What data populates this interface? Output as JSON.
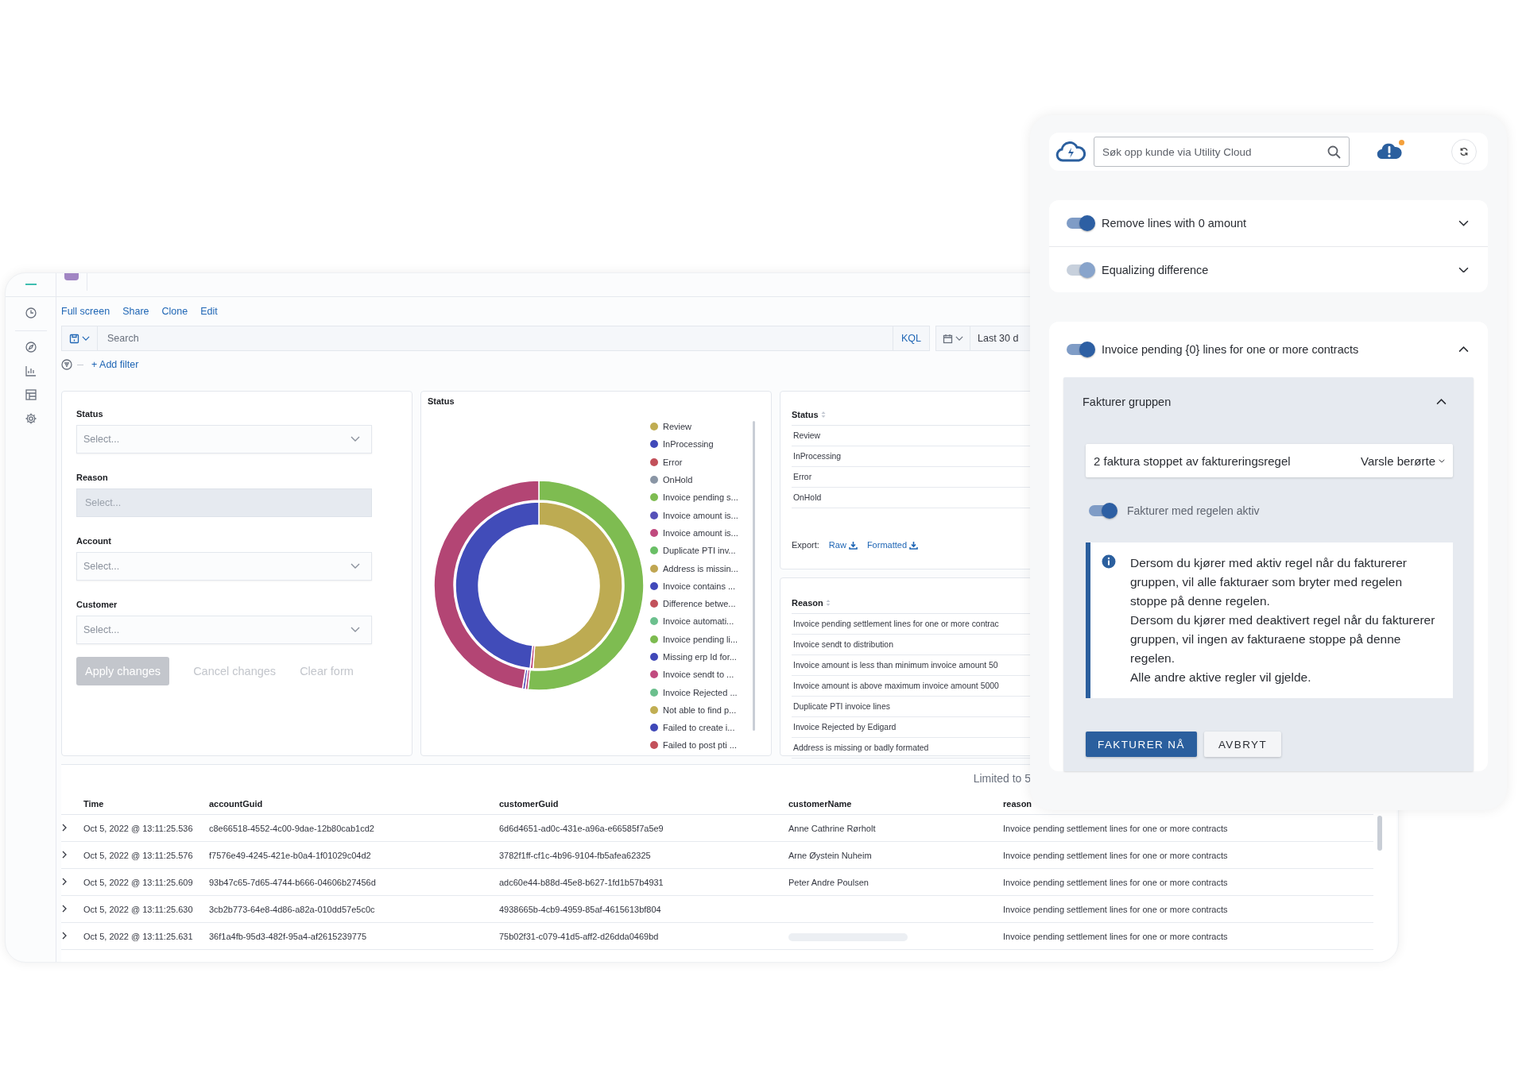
{
  "dashboard": {
    "top_links": [
      "Full screen",
      "Share",
      "Clone",
      "Edit"
    ],
    "search": {
      "placeholder": "Search",
      "language": "KQL"
    },
    "date_range": "Last 30 d",
    "add_filter": "+ Add filter",
    "filters": {
      "fields": [
        {
          "label": "Status",
          "placeholder": "Select...",
          "disabled": false
        },
        {
          "label": "Reason",
          "placeholder": "Select...",
          "disabled": true
        },
        {
          "label": "Account",
          "placeholder": "Select...",
          "disabled": false
        },
        {
          "label": "Customer",
          "placeholder": "Select...",
          "disabled": false
        }
      ],
      "buttons": [
        {
          "label": "Apply changes",
          "kind": "filled",
          "disabled": true
        },
        {
          "label": "Cancel changes",
          "kind": "text",
          "disabled": true
        },
        {
          "label": "Clear form",
          "kind": "text",
          "disabled": true
        }
      ]
    },
    "status_chart": {
      "title": "Status",
      "legend": [
        {
          "label": "Review",
          "color": "#c0ad52"
        },
        {
          "label": "InProcessing",
          "color": "#4049b9"
        },
        {
          "label": "Error",
          "color": "#c2505a"
        },
        {
          "label": "OnHold",
          "color": "#8a96a5"
        },
        {
          "label": "Invoice pending s...",
          "color": "#7ebc51"
        },
        {
          "label": "Invoice amount is...",
          "color": "#5651b8"
        },
        {
          "label": "Invoice amount is...",
          "color": "#c04a7e"
        },
        {
          "label": "Duplicate PTI inv...",
          "color": "#6abf66"
        },
        {
          "label": "Address is missin...",
          "color": "#c0a652"
        },
        {
          "label": "Invoice contains ...",
          "color": "#4149ba"
        },
        {
          "label": "Difference betwe...",
          "color": "#c2515b"
        },
        {
          "label": "Invoice automati...",
          "color": "#6cc08e"
        },
        {
          "label": "Invoice pending li...",
          "color": "#7dbb50"
        },
        {
          "label": "Missing erp Id for...",
          "color": "#4048b8"
        },
        {
          "label": "Invoice sendt to ...",
          "color": "#c14b7f"
        },
        {
          "label": "Invoice Rejected ...",
          "color": "#6bbf8d"
        },
        {
          "label": "Not able to find p...",
          "color": "#c1ae53"
        },
        {
          "label": "Failed to create i...",
          "color": "#3f48b8"
        },
        {
          "label": "Failed to post pti ...",
          "color": "#c3515b"
        }
      ]
    },
    "status_table": {
      "column": "Status",
      "rows": [
        "Review",
        "InProcessing",
        "Error",
        "OnHold"
      ],
      "export_label": "Export:",
      "export_links": [
        "Raw",
        "Formatted"
      ]
    },
    "reason_table": {
      "column": "Reason",
      "rows": [
        "Invoice pending settlement lines for one or more contrac",
        "Invoice sendt to distribution",
        "Invoice amount is less than minimum invoice amount 50",
        "Invoice amount is above maximum invoice amount 5000",
        "Duplicate PTI invoice lines",
        "Invoice Rejected by Edigard",
        "Address is missing or badly formated"
      ]
    },
    "documents": {
      "hits": "Limited to 5",
      "columns": [
        "Time",
        "accountGuid",
        "customerGuid",
        "customerName",
        "reason"
      ],
      "rows": [
        {
          "time": "Oct 5, 2022 @ 13:11:25.536",
          "account_guid": "c8e66518-4552-4c00-9dae-12b80cab1cd2",
          "customer_guid": "6d6d4651-ad0c-431e-a96a-e66585f7a5e9",
          "customer_name": "Anne Cathrine Rørholt",
          "reason": "Invoice pending settlement lines for one or more contracts",
          "loading": false
        },
        {
          "time": "Oct 5, 2022 @ 13:11:25.576",
          "account_guid": "f7576e49-4245-421e-b0a4-1f01029c04d2",
          "customer_guid": "3782f1ff-cf1c-4b96-9104-fb5afea62325",
          "customer_name": "Arne Øystein Nuheim",
          "reason": "Invoice pending settlement lines for one or more contracts",
          "loading": false
        },
        {
          "time": "Oct 5, 2022 @ 13:11:25.609",
          "account_guid": "93b47c65-7d65-4744-b666-04606b27456d",
          "customer_guid": "adc60e44-b88d-45e8-b627-1fd1b57b4931",
          "customer_name": "Peter Andre Poulsen",
          "reason": "Invoice pending settlement lines for one or more contracts",
          "loading": false
        },
        {
          "time": "Oct 5, 2022 @ 13:11:25.630",
          "account_guid": "3cb2b773-64e8-4d86-a82a-010dd57e5c0c",
          "customer_guid": "4938665b-4cb9-4959-85af-4615613bf804",
          "reason": "Invoice pending settlement lines for one or more contracts",
          "loading": false
        },
        {
          "time": "Oct 5, 2022 @ 13:11:25.631",
          "account_guid": "36f1a4fb-95d3-482f-95a4-af2615239775",
          "customer_guid": "75b02f31-c079-41d5-aff2-d26dda0469bd",
          "reason": "Invoice pending settlement lines for one or more contracts",
          "loading": true
        }
      ]
    }
  },
  "rules_panel": {
    "search": {
      "placeholder": "Søk opp kunde via Utility Cloud"
    },
    "notification": true,
    "rules": [
      {
        "label": "Remove lines with 0 amount",
        "on": true,
        "disabled": false,
        "expanded": false
      },
      {
        "label": "Equalizing difference",
        "on": true,
        "disabled": true,
        "expanded": false
      }
    ],
    "active_rule": {
      "label": "Invoice pending {0} lines for one or more contracts",
      "on": true,
      "disabled": false,
      "expanded": true,
      "section": {
        "title": "Fakturer gruppen",
        "expanded": true,
        "summary": "2 faktura stoppet av faktureringsregel",
        "action": "Varsle berørte",
        "toggle": {
          "label": "Fakturer med regelen aktiv",
          "on": true
        },
        "info": [
          "Dersom du kjører med aktiv regel når du fakturerer gruppen, vil alle fakturaer som bryter med regelen stoppe på denne regelen.",
          "Dersom du kjører med deaktivert regel når du fakturerer gruppen, vil ingen av fakturaene stoppe på denne regelen.",
          "Alle andre aktive regler vil gjelde."
        ],
        "buttons": [
          {
            "label": "FAKTURER NÅ",
            "kind": "primary"
          },
          {
            "label": "AVBRYT",
            "kind": "secondary"
          }
        ]
      }
    }
  }
}
